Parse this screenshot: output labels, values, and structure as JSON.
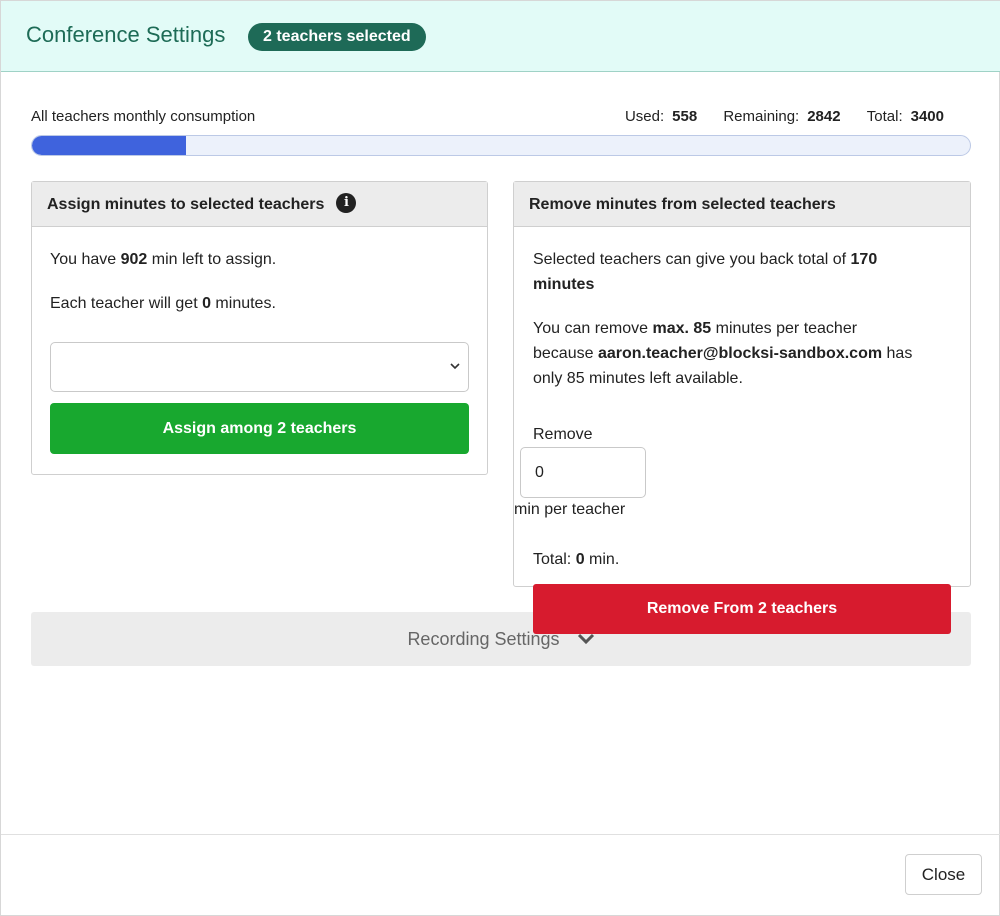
{
  "header": {
    "title": "Conference Settings",
    "badge": "2 teachers selected"
  },
  "consumption": {
    "label": "All teachers monthly consumption",
    "used_label": "Used:",
    "used_value": "558",
    "remaining_label": "Remaining:",
    "remaining_value": "2842",
    "total_label": "Total:",
    "total_value": "3400",
    "progress_fraction": 0.164
  },
  "assign_panel": {
    "title": "Assign minutes to selected teachers",
    "info_icon": "info-icon",
    "left_prefix": "You have ",
    "left_value": "902",
    "left_suffix": " min left to assign.",
    "each_prefix": "Each teacher will get ",
    "each_value": "0",
    "each_suffix": " minutes.",
    "select_value": "",
    "button_label": "Assign among 2 teachers"
  },
  "remove_panel": {
    "title": "Remove minutes from selected teachers",
    "giveback_prefix": "Selected teachers can give you back total of ",
    "giveback_value": "170",
    "giveback_unit": "minutes",
    "max_prefix": "You can remove ",
    "max_value": "max. 85",
    "max_mid": " minutes per teacher",
    "because_prefix": "because ",
    "email": "aaron.teacher@blocksi-sandbox.com",
    "because_suffix": " has",
    "only_line": "only 85 minutes left available.",
    "remove_label": "Remove",
    "remove_value": "0",
    "per_teacher_label": "min per teacher",
    "total_prefix": "Total: ",
    "total_value": "0",
    "total_suffix": " min.",
    "button_label": "Remove From 2 teachers"
  },
  "recording": {
    "label": "Recording Settings",
    "icon": "chevron-down-icon"
  },
  "footer": {
    "close_label": "Close"
  },
  "colors": {
    "header_bg": "#e2fbf7",
    "brand": "#1e6a57",
    "progress": "#3f63dd",
    "assign": "#18a82f",
    "remove": "#d71b2e"
  }
}
